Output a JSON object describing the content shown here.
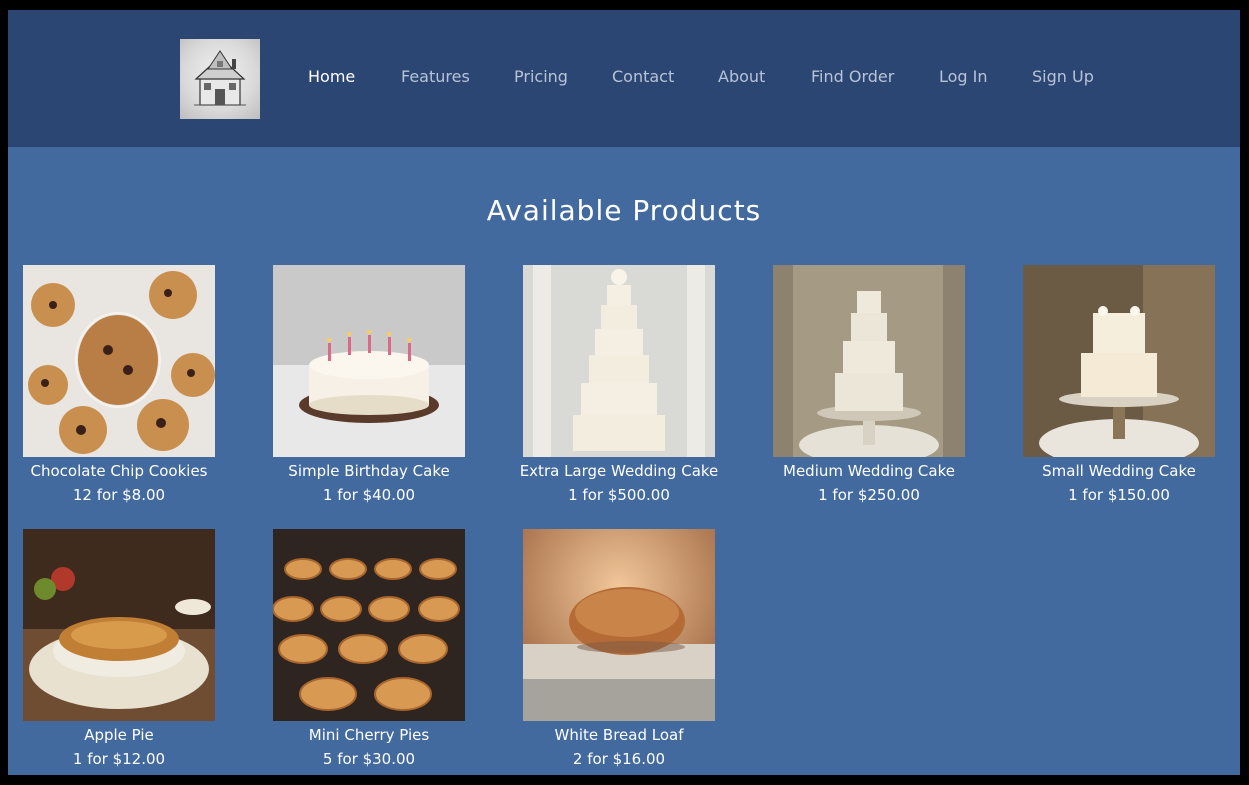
{
  "nav": {
    "items": [
      {
        "label": "Home",
        "active": true
      },
      {
        "label": "Features",
        "active": false
      },
      {
        "label": "Pricing",
        "active": false
      },
      {
        "label": "Contact",
        "active": false
      },
      {
        "label": "About",
        "active": false
      },
      {
        "label": "Find Order",
        "active": false
      },
      {
        "label": "Log In",
        "active": false
      },
      {
        "label": "Sign Up",
        "active": false
      }
    ]
  },
  "main": {
    "title": "Available Products",
    "products": [
      {
        "name": "Chocolate Chip Cookies",
        "price": "12 for $8.00"
      },
      {
        "name": "Simple Birthday Cake",
        "price": "1 for $40.00"
      },
      {
        "name": "Extra Large Wedding Cake",
        "price": "1 for $500.00"
      },
      {
        "name": "Medium Wedding Cake",
        "price": "1 for $250.00"
      },
      {
        "name": "Small Wedding Cake",
        "price": "1 for $150.00"
      },
      {
        "name": "Apple Pie",
        "price": "1 for $12.00"
      },
      {
        "name": "Mini Cherry Pies",
        "price": "5 for $30.00"
      },
      {
        "name": "White Bread Loaf",
        "price": "2 for $16.00"
      }
    ]
  },
  "colors": {
    "header_bg": "#2c4673",
    "page_bg": "#426a9e",
    "nav_text": "#b7c3d6",
    "nav_active": "#ffffff"
  }
}
